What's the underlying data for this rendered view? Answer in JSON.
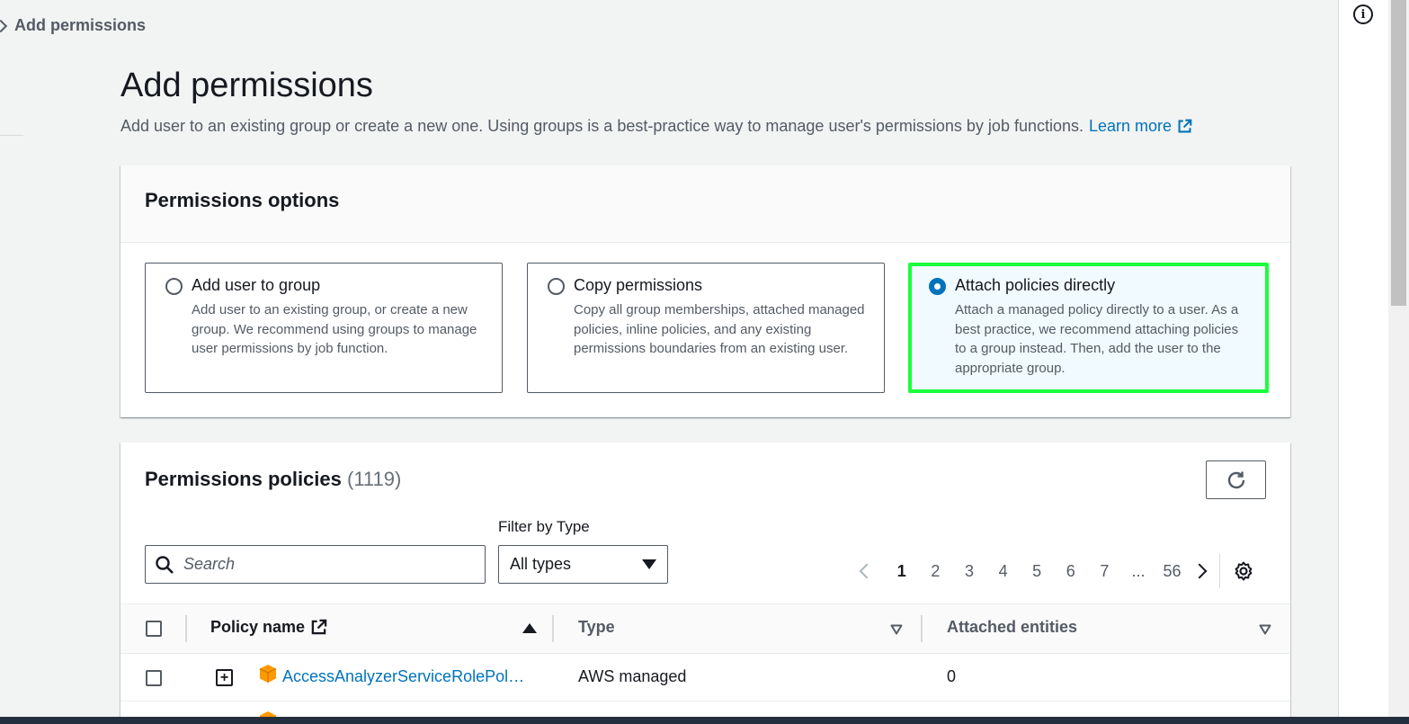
{
  "breadcrumb": {
    "current": "Add permissions"
  },
  "page": {
    "title": "Add permissions",
    "description": "Add user to an existing group or create a new one. Using groups is a best-practice way to manage user's permissions by job functions.",
    "learn_more": "Learn more"
  },
  "permissions_options": {
    "title": "Permissions options",
    "options": [
      {
        "title": "Add user to group",
        "description": "Add user to an existing group, or create a new group. We recommend using groups to manage user permissions by job function.",
        "selected": false
      },
      {
        "title": "Copy permissions",
        "description": "Copy all group memberships, attached managed policies, inline policies, and any existing permissions boundaries from an existing user.",
        "selected": false
      },
      {
        "title": "Attach policies directly",
        "description": "Attach a managed policy directly to a user. As a best practice, we recommend attaching policies to a group instead. Then, add the user to the appropriate group.",
        "selected": true
      }
    ]
  },
  "permissions_policies": {
    "title": "Permissions policies",
    "count": "(1119)",
    "filter_label": "Filter by Type",
    "search_placeholder": "Search",
    "type_filter_value": "All types",
    "pagination": {
      "pages": [
        "1",
        "2",
        "3",
        "4",
        "5",
        "6",
        "7",
        "...",
        "56"
      ],
      "current": "1"
    },
    "columns": {
      "policy_name": "Policy name",
      "type": "Type",
      "attached_entities": "Attached entities"
    },
    "rows": [
      {
        "policy_name": "AccessAnalyzerServiceRolePol…",
        "type": "AWS managed",
        "attached_entities": "0"
      }
    ]
  },
  "colors": {
    "link": "#0073bb",
    "selected_highlight": "#1aff3c",
    "selected_bg": "#f1faff"
  },
  "icons": [
    "chevron-right-icon",
    "info-icon",
    "external-link-icon",
    "refresh-icon",
    "search-icon",
    "caret-down-icon",
    "chevron-left-icon",
    "settings-gear-icon",
    "sort-ascending-icon",
    "sort-icon",
    "expand-icon",
    "policy-cube-icon"
  ]
}
